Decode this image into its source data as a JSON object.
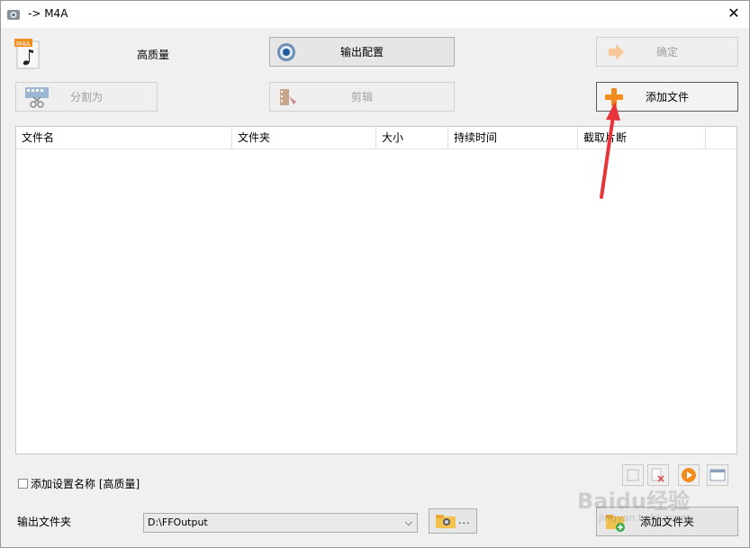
{
  "window": {
    "title": "-> M4A",
    "close_label": "✕"
  },
  "quality": {
    "label": "高质量",
    "format_badge": "M4A"
  },
  "buttons": {
    "output_config": "输出配置",
    "confirm": "确定",
    "split": "分割为",
    "edit": "剪辑",
    "add_file": "添加文件",
    "add_folder": "添加文件夹",
    "browse_dots": "..."
  },
  "file_list": {
    "columns": [
      "文件名",
      "文件夹",
      "大小",
      "持续时间",
      "截取片断"
    ],
    "rows": []
  },
  "options": {
    "add_setting_name_label": "添加设置名称 [高质量]",
    "add_setting_name_checked": false
  },
  "output": {
    "folder_label": "输出文件夹",
    "folder_value": "D:\\FFOutput"
  },
  "watermark": {
    "text": "Baidu经验",
    "subtext": "jingyan.baidu.com"
  },
  "colors": {
    "arrow": "#e8333a",
    "accent_orange": "#f28c1c"
  }
}
